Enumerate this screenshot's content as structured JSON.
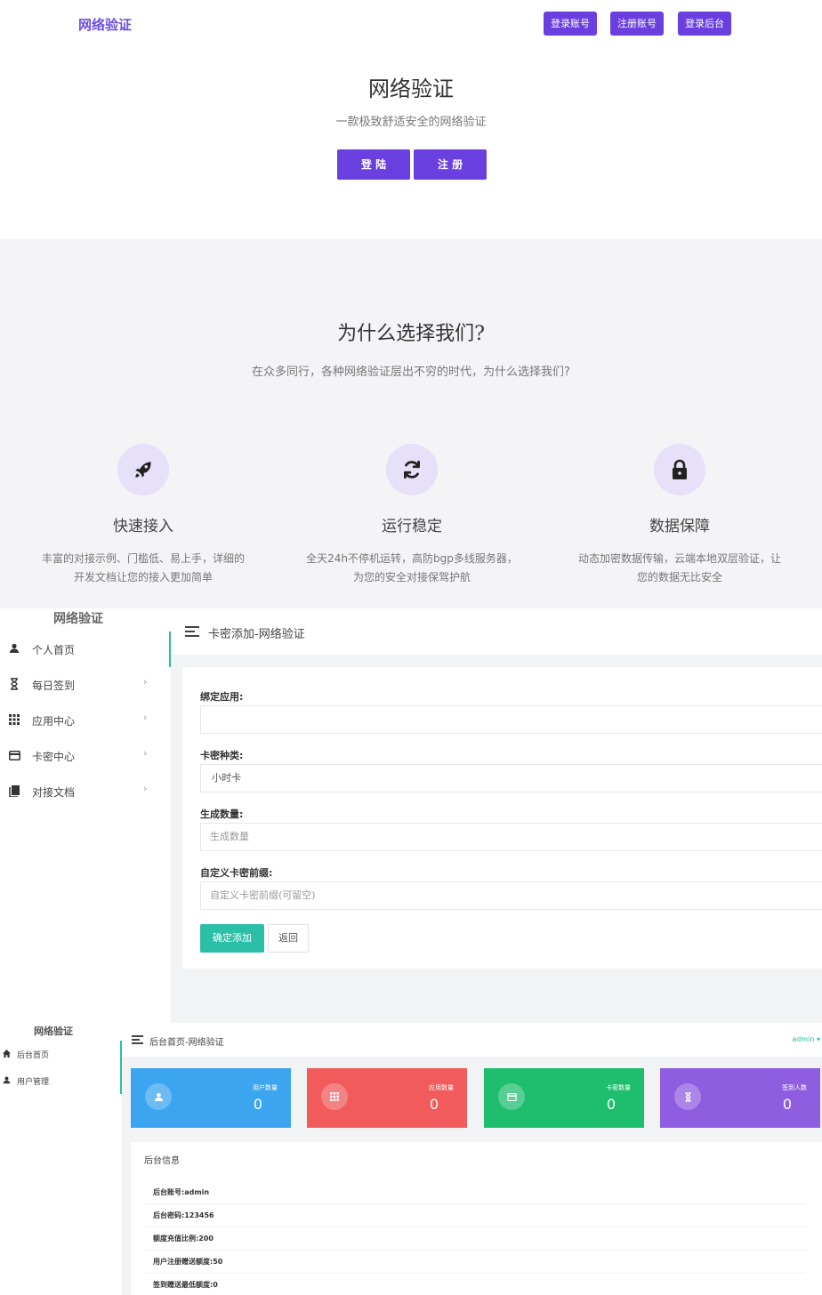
{
  "landing": {
    "brand": "网络验证",
    "nav_buttons": [
      "登录账号",
      "注册账号",
      "登录后台"
    ],
    "hero_title": "网络验证",
    "hero_subtitle": "一款极致舒适安全的网络验证",
    "login_label": "登 陆",
    "register_label": "注 册"
  },
  "features": {
    "title": "为什么选择我们?",
    "subtitle": "在众多同行，各种网络验证层出不穷的时代，为什么选择我们?",
    "items": [
      {
        "icon": "rocket-icon",
        "title": "快速接入",
        "desc_1": "丰富的对接示例、门槛低、易上手，详细的",
        "desc_2": "开发文档让您的接入更加简单"
      },
      {
        "icon": "refresh-icon",
        "title": "运行稳定",
        "desc_1": "全天24h不停机运转，高防bgp多线服务器，",
        "desc_2": "为您的安全对接保驾护航"
      },
      {
        "icon": "lock-icon",
        "title": "数据保障",
        "desc_1": "动态加密数据传输，云端本地双层验证，让",
        "desc_2": "您的数据无比安全"
      }
    ],
    "icon_bg": "#e6e0f8",
    "accent": "#6a3fe0"
  },
  "admin_card": {
    "logo": "网络验证",
    "menu": [
      {
        "icon": "user-icon",
        "label": "个人首页",
        "chev": ""
      },
      {
        "icon": "hourglass-icon",
        "label": "每日签到",
        "chev": "›"
      },
      {
        "icon": "grid-icon",
        "label": "应用中心",
        "chev": "›"
      },
      {
        "icon": "card-icon",
        "label": "卡密中心",
        "chev": "›"
      },
      {
        "icon": "book-icon",
        "label": "对接文档",
        "chev": "›"
      }
    ],
    "breadcrumb": "卡密添加-网络验证",
    "form": {
      "app_label": "绑定应用:",
      "app_value": "",
      "type_label": "卡密种类:",
      "type_value": "小时卡",
      "count_label": "生成数量:",
      "count_placeholder": "生成数量",
      "prefix_label": "自定义卡密前缀:",
      "prefix_placeholder": "自定义卡密前缀(可留空)",
      "submit_label": "确定添加",
      "back_label": "返回"
    },
    "accent": "#2bbfa7"
  },
  "dashboard": {
    "logo": "网络验证",
    "menu": [
      "后台首页",
      "用户管理"
    ],
    "breadcrumb": "后台首页-网络验证",
    "user": "admin ▾",
    "stats": [
      {
        "label": "用户数量",
        "value": "0",
        "color": "#3ba5ef",
        "icon": "user-icon"
      },
      {
        "label": "应用数量",
        "value": "0",
        "color": "#f15b5b",
        "icon": "grid-icon"
      },
      {
        "label": "卡密数量",
        "value": "0",
        "color": "#1fbe6f",
        "icon": "card-icon"
      },
      {
        "label": "签到人数",
        "value": "0",
        "color": "#8f5ee0",
        "icon": "hourglass-icon"
      }
    ],
    "info_title": "后台信息",
    "info_rows": [
      "后台账号:admin",
      "后台密码:123456",
      "额度充值比例:200",
      "用户注册赠送额度:50",
      "签到赠送最低额度:0"
    ]
  }
}
